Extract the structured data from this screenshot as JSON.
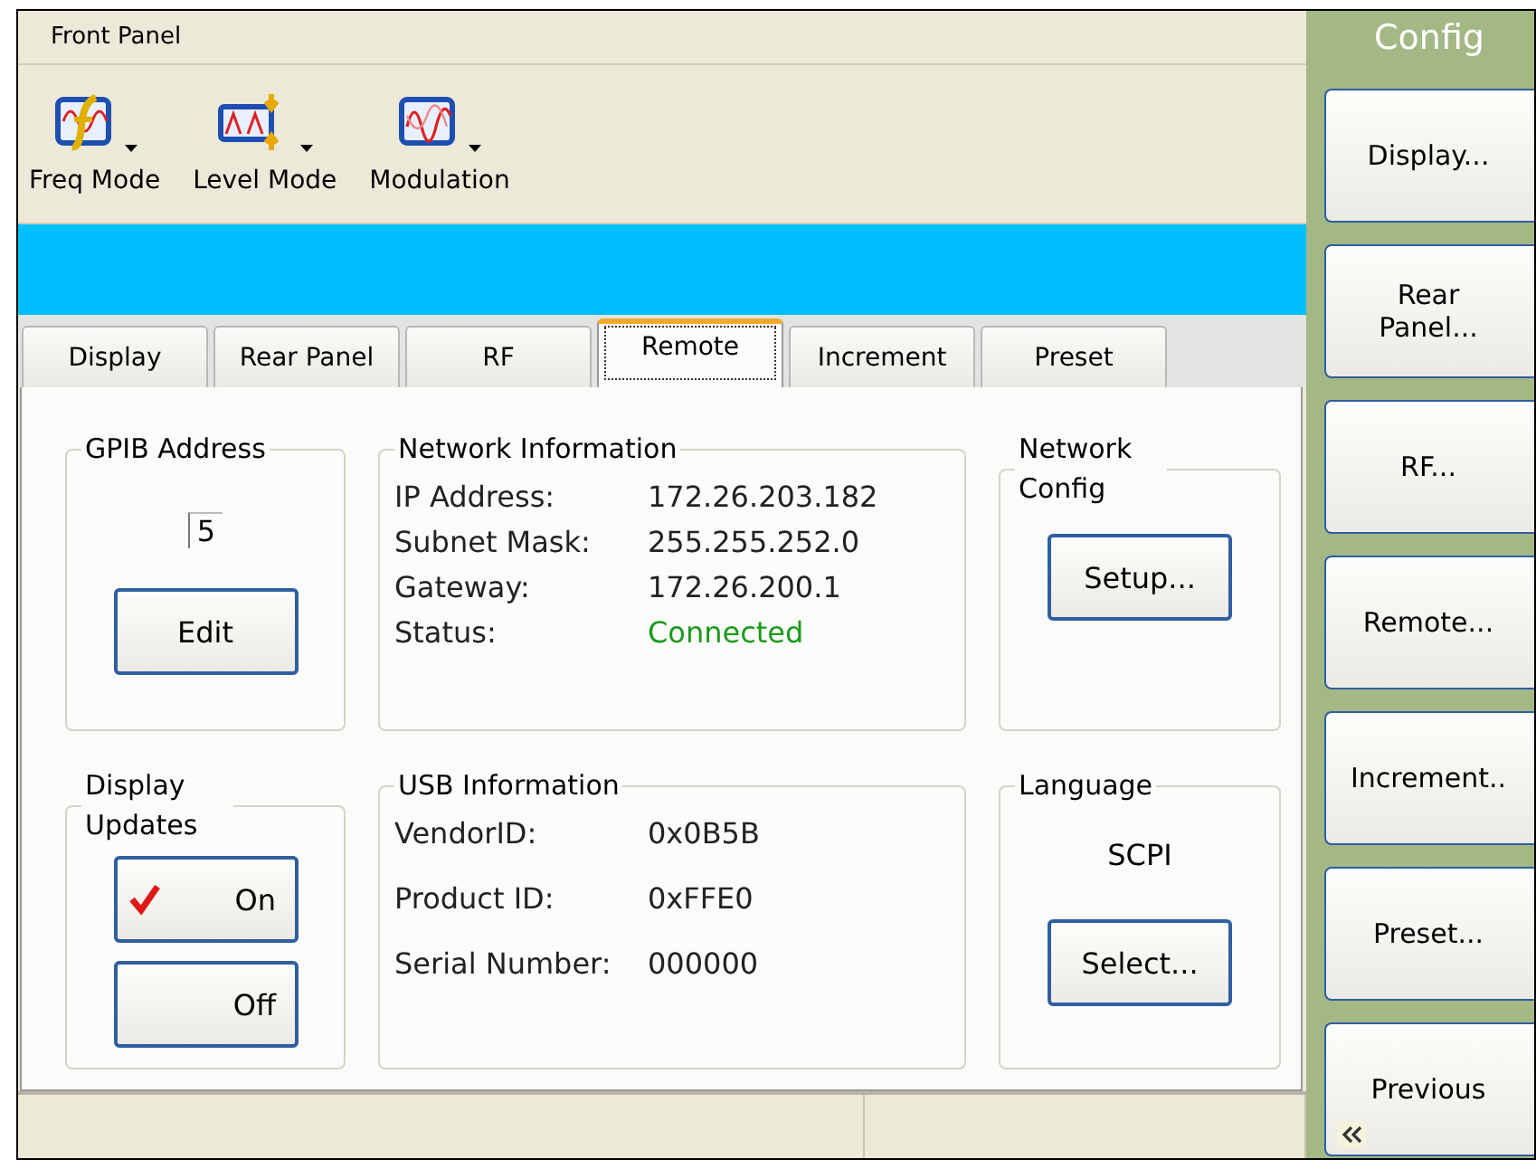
{
  "header": {
    "title": "Front Panel"
  },
  "toolbar": [
    {
      "label": "Freq Mode",
      "kind": "freq"
    },
    {
      "label": "Level Mode",
      "kind": "level"
    },
    {
      "label": "Modulation",
      "kind": "modulation"
    }
  ],
  "tabs": [
    {
      "label": "Display",
      "selected": false
    },
    {
      "label": "Rear Panel",
      "selected": false
    },
    {
      "label": "RF",
      "selected": false
    },
    {
      "label": "Remote",
      "selected": true
    },
    {
      "label": "Increment",
      "selected": false
    },
    {
      "label": "Preset",
      "selected": false
    }
  ],
  "gpib": {
    "title": "GPIB Address",
    "value": "5",
    "button": "Edit"
  },
  "network": {
    "title": "Network Information",
    "rows": [
      {
        "label": "IP Address:",
        "value": "172.26.203.182",
        "kind": "text"
      },
      {
        "label": "Subnet Mask:",
        "value": "255.255.252.0",
        "kind": "text"
      },
      {
        "label": "Gateway:",
        "value": "172.26.200.1",
        "kind": "text"
      },
      {
        "label": "Status:",
        "value": "Connected",
        "kind": "status"
      }
    ]
  },
  "network_config": {
    "title": "Network Config",
    "button": "Setup..."
  },
  "display_updates": {
    "title": "Display Updates",
    "options": [
      {
        "label": "On",
        "selected": true
      },
      {
        "label": "Off",
        "selected": false
      }
    ]
  },
  "usb": {
    "title": "USB Information",
    "rows": [
      {
        "label": "VendorID:",
        "value": "0x0B5B"
      },
      {
        "label": "Product ID:",
        "value": "0xFFE0"
      },
      {
        "label": "Serial Number:",
        "value": "000000"
      }
    ]
  },
  "language": {
    "title": "Language",
    "value": "SCPI",
    "button": "Select..."
  },
  "sidebar": {
    "title": "Config",
    "buttons": [
      "Display...",
      "Rear Panel...",
      "RF...",
      "Remote...",
      "Increment..",
      "Preset...",
      "Previous"
    ]
  }
}
